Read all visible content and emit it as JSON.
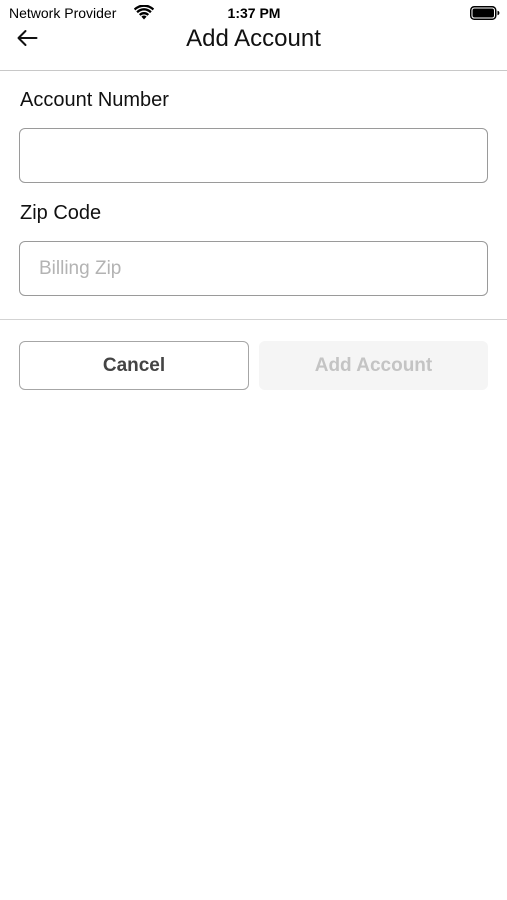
{
  "status_bar": {
    "carrier": "Network Provider",
    "time": "1:37 PM",
    "wifi_icon": "wifi-icon",
    "battery_icon": "battery-full-icon"
  },
  "nav": {
    "back_icon": "arrow-left-icon",
    "title": "Add Account"
  },
  "form": {
    "account_number": {
      "label": "Account Number",
      "value": "",
      "placeholder": ""
    },
    "zip_code": {
      "label": "Zip Code",
      "value": "",
      "placeholder": "Billing Zip"
    }
  },
  "actions": {
    "cancel_label": "Cancel",
    "add_label": "Add Account",
    "add_disabled": true
  },
  "colors": {
    "border": "#9a9a9a",
    "disabled_bg": "#f5f5f5",
    "disabled_text": "#c4c4c4",
    "divider": "#d3d3d3"
  }
}
